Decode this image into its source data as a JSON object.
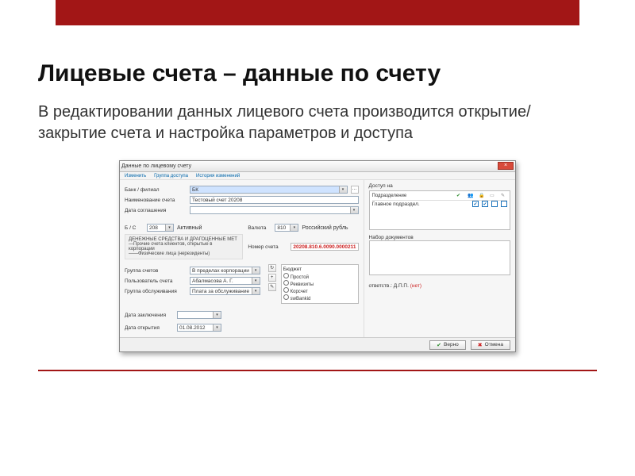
{
  "slide": {
    "heading": "Лицевые счета – данные по счету",
    "subtitle": "В редактировании данных лицевого счета производится открытие/закрытие счета и настройка параметров и доступа"
  },
  "window": {
    "title": "Данные по лицевому счету",
    "menu": [
      "Изменить",
      "Группа доступа",
      "История изменений"
    ],
    "close": "×",
    "buttons": {
      "ok": "Верно",
      "cancel": "Отмена"
    }
  },
  "form": {
    "bank_label": "Банк / филиал",
    "bank_value": "БК",
    "name_label": "Наименование счета",
    "name_value": "Тестовый счет 20208",
    "agreement_label": "Дата соглашения",
    "bs_label": "Б / С",
    "bs_value": "208",
    "active": "Активный",
    "currency_label": "Валюта",
    "currency_code": "810",
    "currency_name": "Российский рубль",
    "detail1": "ДЕНЕЖНЫЕ СРЕДСТВА И ДРАГОЦЕННЫЕ МЕТ",
    "detail2": "—Прочие счета клиентов, открытые в корпорации",
    "detail3": "——Физические лица (нерезиденты)",
    "number_label": "Номер счета",
    "number_value": "20208.810.6.0090.0000211",
    "group_label": "Группа счетов",
    "group_value": "В пределах корпорации",
    "user_label": "Пользователь счета",
    "user_value": "Абалмасова А. Г.",
    "service_label": "Группа обслуживания",
    "service_value": "Плата за обслуживание",
    "budget_label": "Бюджет",
    "budget_items": [
      "Простой",
      "Реквизиты",
      "Корсчет",
      "swBankid"
    ],
    "docset_label": "Набор документов",
    "contract_date_label": "Дата заключения",
    "open_date_label": "Дата открытия",
    "open_date_value": "01.08.2012",
    "responsible_label": "ответств.: Д.П.П.",
    "responsible_none": "(нет)"
  },
  "access": {
    "header": "Доступ на",
    "columns": [
      "Подразделение"
    ],
    "row": "Главное подраздел."
  }
}
